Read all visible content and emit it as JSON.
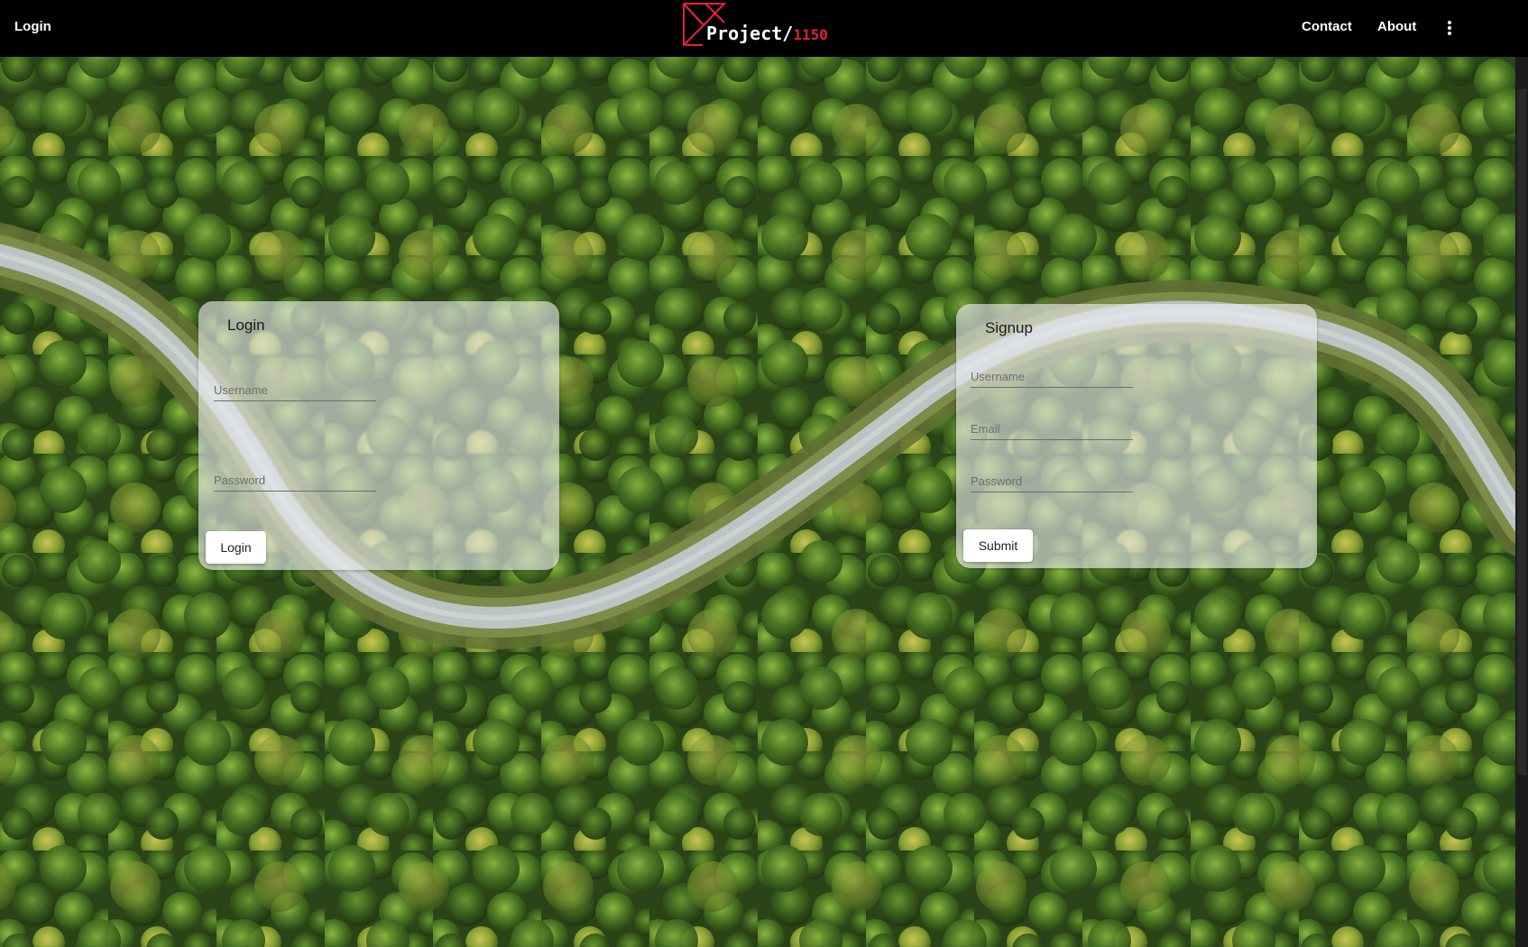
{
  "header": {
    "login_link": "Login",
    "brand_text": "Project/",
    "brand_number": "1150",
    "nav": {
      "contact": "Contact",
      "about": "About"
    },
    "menu_icon": "kebab-menu-icon"
  },
  "login_card": {
    "title": "Login",
    "username_placeholder": "Username",
    "password_placeholder": "Password",
    "button_label": "Login"
  },
  "signup_card": {
    "title": "Signup",
    "username_placeholder": "Username",
    "email_placeholder": "Email",
    "password_placeholder": "Password",
    "button_label": "Submit"
  },
  "colors": {
    "header_bg": "#000000",
    "brand_accent": "#e0203a",
    "forest_dark": "#1f3d12",
    "forest_light": "#5f8f2a",
    "road": "#b9c2c6"
  }
}
